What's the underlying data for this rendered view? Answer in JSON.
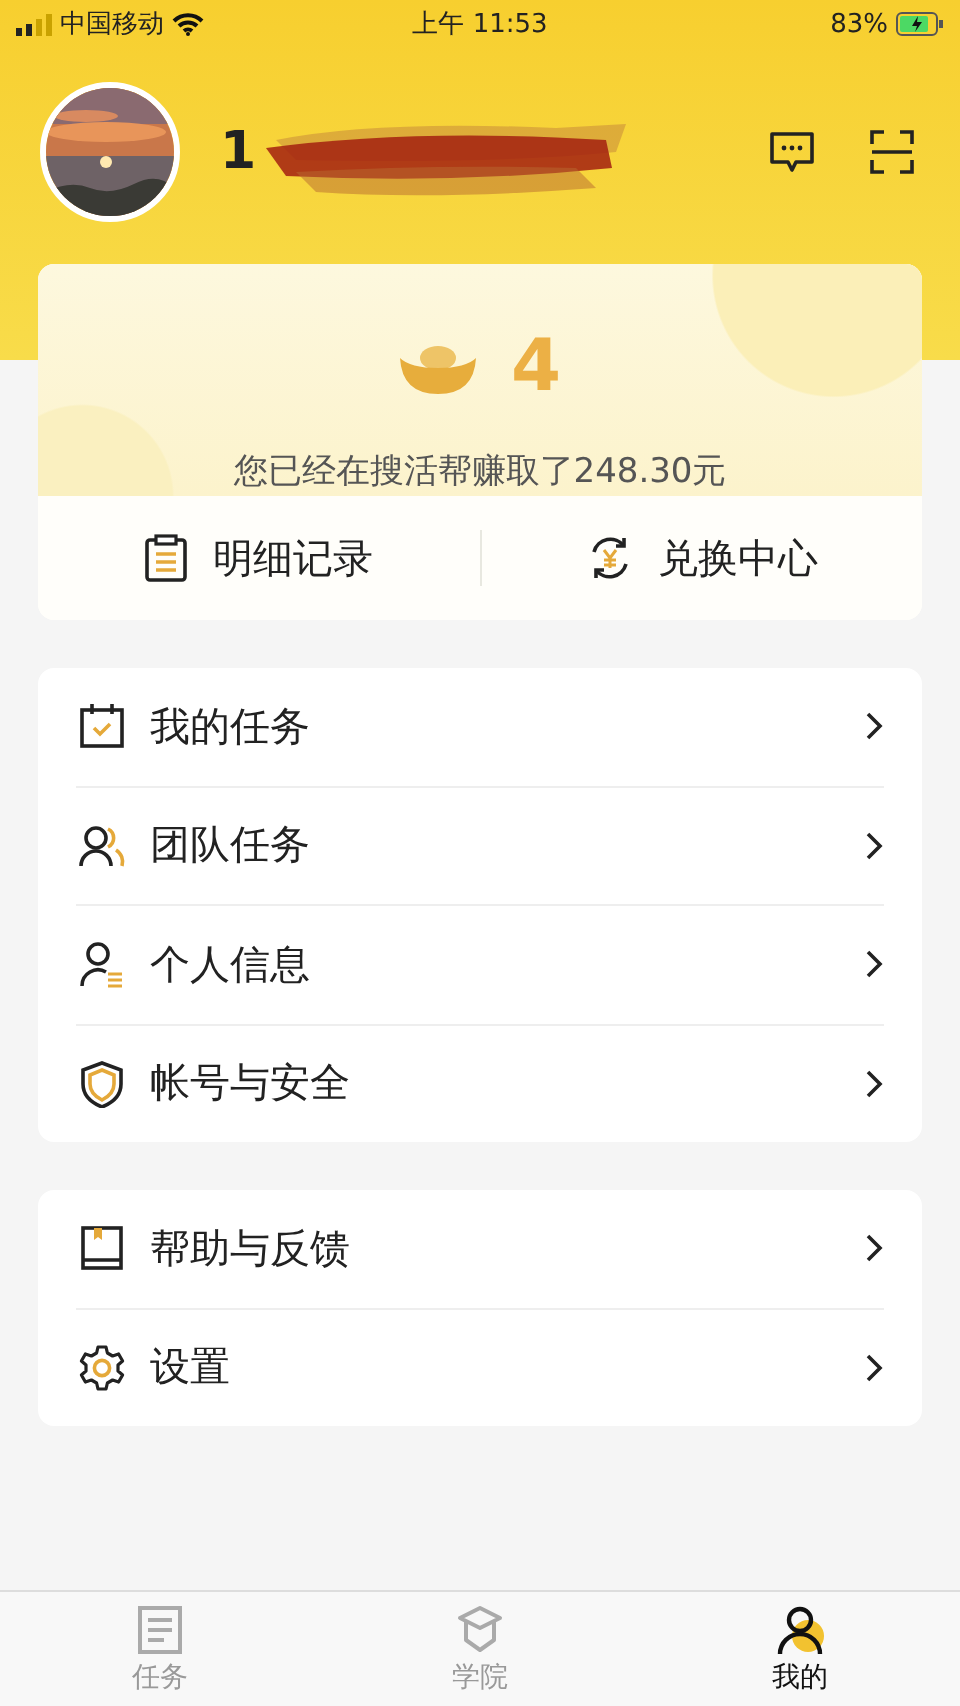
{
  "status_bar": {
    "carrier": "中国移动",
    "time": "上午 11:53",
    "battery": "83%"
  },
  "profile": {
    "username": "1"
  },
  "balance": {
    "amount": "4",
    "earned_text": "您已经在搜活帮赚取了248.30元",
    "actions": [
      {
        "label": "明细记录"
      },
      {
        "label": "兑换中心"
      }
    ]
  },
  "menu_groups": [
    {
      "items": [
        {
          "label": "我的任务"
        },
        {
          "label": "团队任务"
        },
        {
          "label": "个人信息"
        },
        {
          "label": "帐号与安全"
        }
      ]
    },
    {
      "items": [
        {
          "label": "帮助与反馈"
        },
        {
          "label": "设置"
        }
      ]
    }
  ],
  "tab_bar": [
    {
      "label": "任务",
      "selected": false
    },
    {
      "label": "学院",
      "selected": false
    },
    {
      "label": "我的",
      "selected": true
    }
  ]
}
